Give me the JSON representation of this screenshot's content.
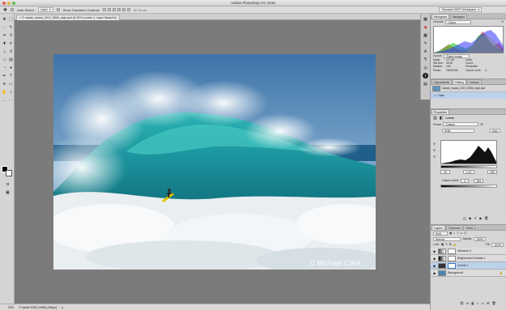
{
  "window": {
    "title": "Adobe Photoshop CC 2015"
  },
  "options_bar": {
    "auto_select_label": "Auto-Select:",
    "auto_select_value": "Layer",
    "show_transform_label": "Show Transform Controls",
    "mode_3d_label": "3D Mode:",
    "workspace": "Standard WDP Workspace"
  },
  "document_tab": {
    "label": "© mclark_hawai_0213_5506_argb.psd @ 25% (Levels 1, Layer Mask/16)"
  },
  "canvas": {
    "watermark": "© Michael Clark"
  },
  "status_bar": {
    "zoom": "25%",
    "profile": "© Adobe RGB (1998) (16bpc)"
  },
  "histogram_panel": {
    "tabs": [
      "Histogram",
      "Navigator"
    ],
    "channel_label": "Channel:",
    "channel_value": "Colors",
    "source_label": "Source:",
    "source_value": "Entire Image",
    "stats_left": [
      "Mean:",
      "Std Dev:",
      "Median:",
      "Pixels:"
    ],
    "stats_left_values": [
      "177.49",
      "49.92",
      "149",
      "29420000"
    ],
    "stats_right": [
      "Level:",
      "Count:",
      "Percentile:",
      "Cache Level:"
    ],
    "stats_right_values": [
      "",
      "",
      "",
      "4"
    ]
  },
  "history_panel": {
    "tabs": [
      "Adjustments",
      "History",
      "Actions"
    ],
    "snapshot": "mclark_hawai_0213_5506_argb.psd",
    "items": [
      "Open"
    ]
  },
  "properties_panel": {
    "tabs": [
      "Properties"
    ],
    "title": "Levels",
    "preset_label": "Preset:",
    "preset_value": "Custom",
    "channel_value": "RGB",
    "auto_label": "Auto",
    "input_values": [
      "29",
      "1.00",
      "255"
    ],
    "output_label": "Output Levels:",
    "output_values": [
      "0",
      "255"
    ]
  },
  "layers_panel": {
    "tabs": [
      "Layers",
      "Channels",
      "Paths"
    ],
    "kind_label": "Kind",
    "blend_mode": "Normal",
    "opacity_label": "Opacity:",
    "opacity_value": "100%",
    "lock_label": "Lock:",
    "fill_label": "Fill:",
    "fill_value": "100%",
    "layers": [
      {
        "name": "Vibrance 1",
        "selected": false
      },
      {
        "name": "Brightness/Contrast 1",
        "selected": false
      },
      {
        "name": "Levels 1",
        "selected": true
      },
      {
        "name": "Background",
        "selected": false
      }
    ]
  },
  "colors": {
    "accent": "#3b79c9",
    "canvas_bg": "#7b7b7b",
    "panel_bg": "#d6d6d6"
  }
}
